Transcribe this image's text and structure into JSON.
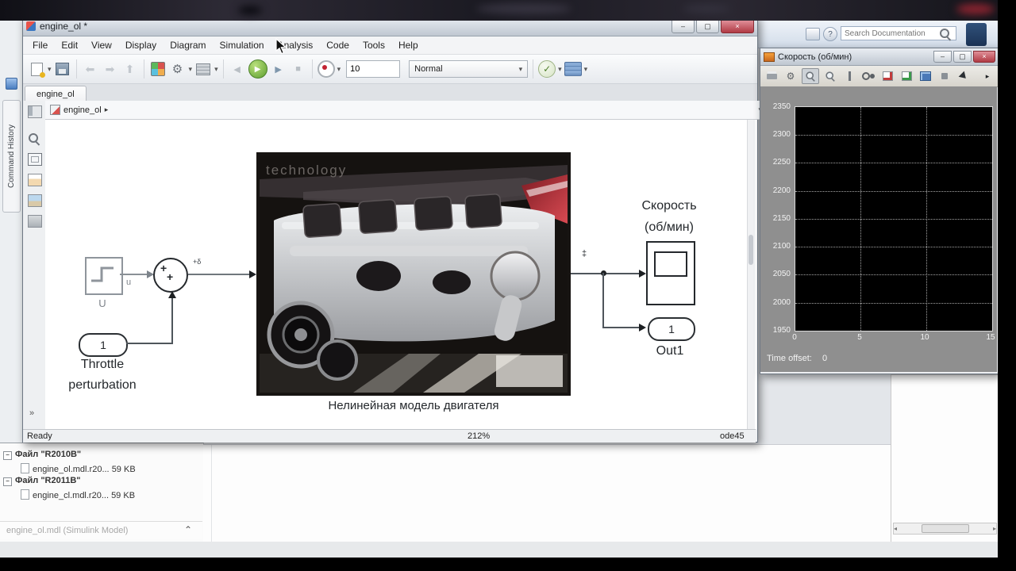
{
  "icons": {
    "caret_down": "▾",
    "breadcrumb_sep": "▸",
    "overflow_chevrons": "»",
    "collapse_up": "⌃",
    "close": "×",
    "minimize": "–",
    "maximize": "▢",
    "check": "✓",
    "play": "▶",
    "play_left": "◀",
    "stop": "■",
    "gear": "⚙",
    "minus": "−",
    "scroll_left": "◂",
    "scroll_right": "▸",
    "question": "?"
  },
  "matlab": {
    "toolstrip": {
      "search_placeholder": "Search Documentation"
    },
    "left_panel": {
      "command_history_label": "Command History"
    },
    "files": [
      {
        "label": "Файл \"R2010B\"",
        "file": "engine_ol.mdl.r20...",
        "size": "59 KB"
      },
      {
        "label": "Файл \"R2011B\"",
        "file": "engine_cl.mdl.r20...",
        "size": "59 KB"
      }
    ],
    "selection_status": "engine_ol.mdl (Simulink Model)"
  },
  "simulink": {
    "window_title": "engine_ol *",
    "menu": [
      "File",
      "Edit",
      "View",
      "Display",
      "Diagram",
      "Simulation",
      "Analysis",
      "Code",
      "Tools",
      "Help"
    ],
    "toolbar": {
      "sim_stop_time": "10",
      "sim_mode": "Normal"
    },
    "tab_label": "engine_ol",
    "breadcrumb": "engine_ol",
    "statusbar": {
      "ready": "Ready",
      "zoom": "212%",
      "solver": "ode45"
    },
    "diagram": {
      "step_block_label": "U",
      "step_signal_label": "u",
      "sum_plus_1": "+",
      "sum_plus_2": "+",
      "sum_out_badge": "+δ",
      "signal_badge": "‡",
      "throttle_port_value": "1",
      "throttle_label_1": "Throttle",
      "throttle_label_2": "perturbation",
      "engine_watermark": "technology",
      "engine_caption": "Нелинейная модель двигателя",
      "scope_label_1": "Скорость",
      "scope_label_2": "(об/мин)",
      "outport_value": "1",
      "outport_label": "Out1"
    }
  },
  "scope_window": {
    "title": "Скорость (об/мин)",
    "time_offset_label": "Time offset:",
    "time_offset_value": "0",
    "chart_data": {
      "type": "line",
      "title": "Скорость (об/мин)",
      "x": [],
      "series": [],
      "xlim": [
        0,
        15
      ],
      "ylim": [
        1950,
        2350
      ],
      "xticks": [
        "0",
        "5",
        "10",
        "15"
      ],
      "yticks": [
        "2350",
        "2300",
        "2250",
        "2200",
        "2150",
        "2100",
        "2050",
        "2000",
        "1950"
      ],
      "grid": true,
      "plot_bg": "#000000",
      "figure_bg": "#8f8f8f"
    }
  }
}
